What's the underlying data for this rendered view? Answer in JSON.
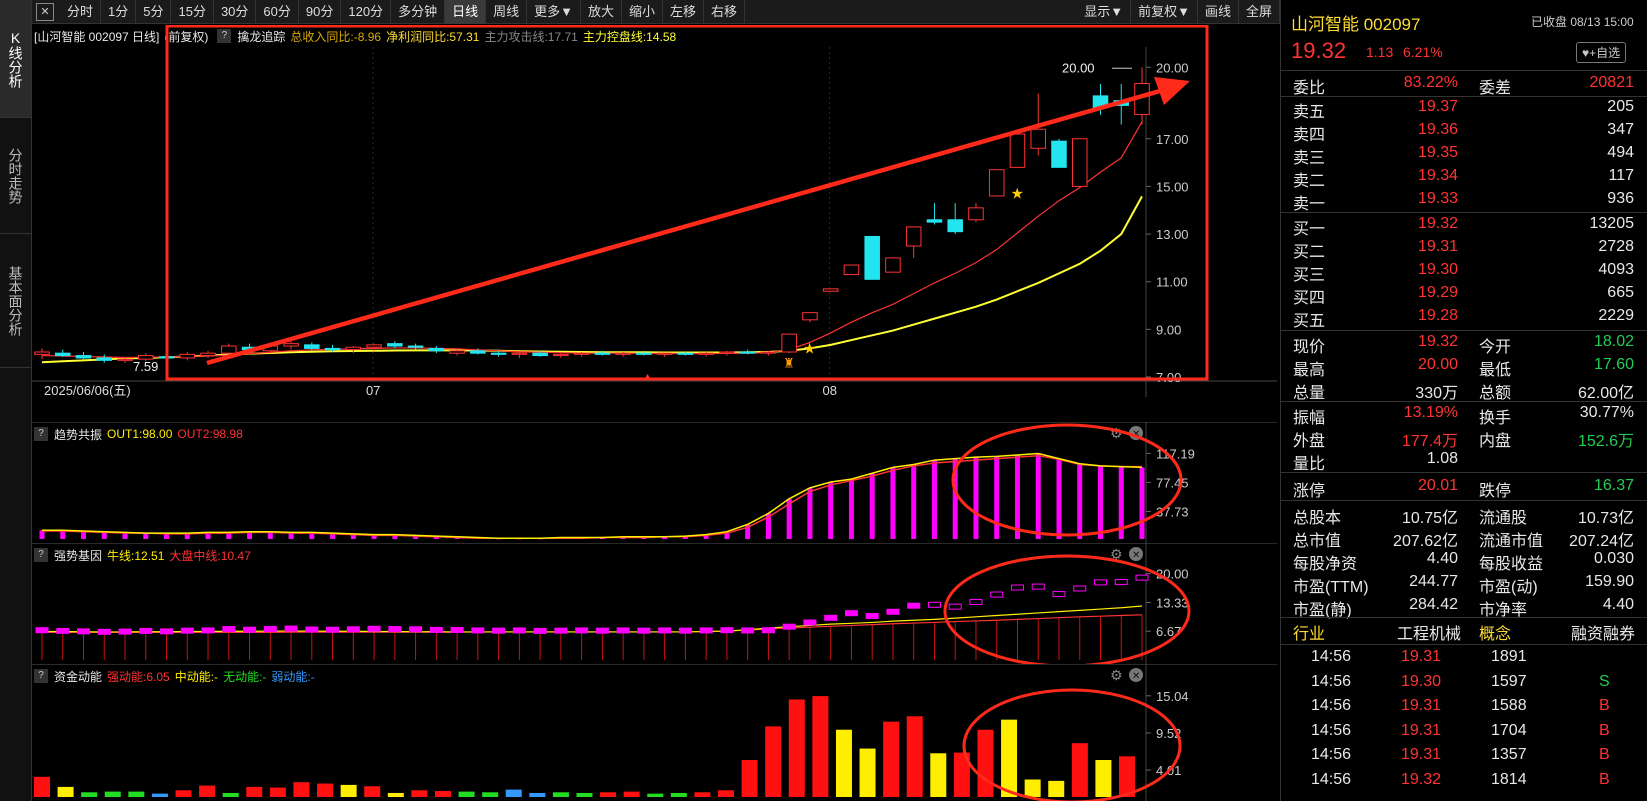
{
  "toolbar": {
    "square_label": "✕",
    "buttons": [
      "分时",
      "1分",
      "5分",
      "15分",
      "30分",
      "60分",
      "90分",
      "120分",
      "多分钟",
      "日线",
      "周线",
      "更多▼",
      "放大",
      "缩小",
      "左移",
      "右移"
    ],
    "right_buttons": [
      "显示▼",
      "前复权▼",
      "画线",
      "全屏"
    ],
    "active": "日线"
  },
  "left_tabs": [
    "K线分析",
    "分时走势",
    "基本面分析"
  ],
  "main_chart": {
    "title": "[山河智能 002097 日线]",
    "adjust": "(前复权)",
    "indicator": "擒龙追踪",
    "f1": "总收入同比:-8.96",
    "f2": "净利润同比:57.31",
    "f3": "主力攻击线:17.71",
    "f4": "主力控盘线:14.58",
    "y_ticks": [
      "20.00",
      "17.00",
      "15.00",
      "13.00",
      "11.00",
      "9.00",
      "7.00"
    ],
    "date_label": "2025/06/06(五)",
    "x_ticks": [
      "07",
      "08"
    ],
    "high_label": "20.00",
    "low_label": "7.59"
  },
  "panel2": {
    "name": "趋势共振",
    "out1": "OUT1:98.00",
    "out2": "OUT2:98.98",
    "y_ticks": [
      "117.19",
      "77.45",
      "37.73"
    ]
  },
  "panel3": {
    "name": "强势基因",
    "bull": "牛线:12.51",
    "market": "大盘中线:10.47",
    "y_ticks": [
      "20.00",
      "13.33",
      "6.67"
    ]
  },
  "panel4": {
    "name": "资金动能",
    "strong": "强动能:6.05",
    "mid": "中动能:-",
    "none": "无动能:-",
    "weak": "弱动能:-",
    "y_ticks": [
      "15.04",
      "9.52",
      "4.01"
    ]
  },
  "chart_data": {
    "type": "candlestick",
    "title": "[山河智能 002097 日线]",
    "ylim": [
      7.0,
      20.6
    ],
    "candles": [
      {
        "o": 7.95,
        "h": 8.2,
        "l": 7.75,
        "c": 8.05
      },
      {
        "o": 8.0,
        "h": 8.15,
        "l": 7.85,
        "c": 7.9
      },
      {
        "o": 7.9,
        "h": 8.05,
        "l": 7.7,
        "c": 7.8
      },
      {
        "o": 7.8,
        "h": 7.95,
        "l": 7.6,
        "c": 7.7
      },
      {
        "o": 7.7,
        "h": 7.85,
        "l": 7.59,
        "c": 7.75
      },
      {
        "o": 7.75,
        "h": 8.0,
        "l": 7.65,
        "c": 7.9
      },
      {
        "o": 7.85,
        "h": 8.0,
        "l": 7.7,
        "c": 7.8
      },
      {
        "o": 7.8,
        "h": 8.05,
        "l": 7.7,
        "c": 7.95
      },
      {
        "o": 7.9,
        "h": 8.1,
        "l": 7.8,
        "c": 8.0
      },
      {
        "o": 8.0,
        "h": 8.4,
        "l": 7.9,
        "c": 8.3
      },
      {
        "o": 8.25,
        "h": 8.4,
        "l": 8.05,
        "c": 8.15
      },
      {
        "o": 8.1,
        "h": 8.35,
        "l": 8.0,
        "c": 8.3
      },
      {
        "o": 8.3,
        "h": 8.5,
        "l": 8.15,
        "c": 8.4
      },
      {
        "o": 8.35,
        "h": 8.45,
        "l": 8.1,
        "c": 8.2
      },
      {
        "o": 8.2,
        "h": 8.35,
        "l": 8.05,
        "c": 8.15
      },
      {
        "o": 8.15,
        "h": 8.3,
        "l": 8.0,
        "c": 8.25
      },
      {
        "o": 8.25,
        "h": 8.4,
        "l": 8.1,
        "c": 8.35
      },
      {
        "o": 8.4,
        "h": 8.5,
        "l": 8.2,
        "c": 8.3
      },
      {
        "o": 8.3,
        "h": 8.4,
        "l": 8.15,
        "c": 8.25
      },
      {
        "o": 8.2,
        "h": 8.3,
        "l": 8.0,
        "c": 8.1
      },
      {
        "o": 8.0,
        "h": 8.15,
        "l": 7.9,
        "c": 8.1
      },
      {
        "o": 8.1,
        "h": 8.2,
        "l": 7.95,
        "c": 8.0
      },
      {
        "o": 8.0,
        "h": 8.1,
        "l": 7.85,
        "c": 7.95
      },
      {
        "o": 7.95,
        "h": 8.05,
        "l": 7.8,
        "c": 8.0
      },
      {
        "o": 8.0,
        "h": 8.1,
        "l": 7.85,
        "c": 7.9
      },
      {
        "o": 7.9,
        "h": 8.0,
        "l": 7.8,
        "c": 7.95
      },
      {
        "o": 7.95,
        "h": 8.05,
        "l": 7.85,
        "c": 8.0
      },
      {
        "o": 8.0,
        "h": 8.1,
        "l": 7.9,
        "c": 7.95
      },
      {
        "o": 7.95,
        "h": 8.05,
        "l": 7.85,
        "c": 8.0
      },
      {
        "o": 8.0,
        "h": 8.1,
        "l": 7.9,
        "c": 7.95
      },
      {
        "o": 7.95,
        "h": 8.0,
        "l": 7.85,
        "c": 8.0
      },
      {
        "o": 8.0,
        "h": 8.05,
        "l": 7.9,
        "c": 7.95
      },
      {
        "o": 7.95,
        "h": 8.05,
        "l": 7.85,
        "c": 8.0
      },
      {
        "o": 8.0,
        "h": 8.1,
        "l": 7.9,
        "c": 8.05
      },
      {
        "o": 8.05,
        "h": 8.15,
        "l": 7.95,
        "c": 8.0
      },
      {
        "o": 8.0,
        "h": 8.1,
        "l": 7.9,
        "c": 8.05
      },
      {
        "o": 8.05,
        "h": 8.8,
        "l": 8.0,
        "c": 8.8
      },
      {
        "o": 9.4,
        "h": 9.7,
        "l": 9.3,
        "c": 9.7
      },
      {
        "o": 10.6,
        "h": 10.7,
        "l": 10.6,
        "c": 10.7
      },
      {
        "o": 11.3,
        "h": 11.7,
        "l": 11.3,
        "c": 11.7
      },
      {
        "o": 12.9,
        "h": 12.9,
        "l": 11.1,
        "c": 11.1
      },
      {
        "o": 11.4,
        "h": 12.0,
        "l": 11.4,
        "c": 12.0
      },
      {
        "o": 12.5,
        "h": 13.3,
        "l": 12.0,
        "c": 13.3
      },
      {
        "o": 13.6,
        "h": 14.3,
        "l": 13.4,
        "c": 13.5
      },
      {
        "o": 13.6,
        "h": 14.3,
        "l": 13.0,
        "c": 13.1
      },
      {
        "o": 13.6,
        "h": 14.3,
        "l": 13.5,
        "c": 14.1
      },
      {
        "o": 14.6,
        "h": 15.7,
        "l": 14.6,
        "c": 15.7
      },
      {
        "o": 15.8,
        "h": 17.2,
        "l": 15.8,
        "c": 17.2
      },
      {
        "o": 16.6,
        "h": 18.9,
        "l": 16.3,
        "c": 17.4
      },
      {
        "o": 16.9,
        "h": 17.0,
        "l": 15.8,
        "c": 15.8
      },
      {
        "o": 15.0,
        "h": 17.0,
        "l": 14.95,
        "c": 17.0
      },
      {
        "o": 18.8,
        "h": 19.3,
        "l": 18.0,
        "c": 18.3
      },
      {
        "o": 18.6,
        "h": 19.3,
        "l": 17.6,
        "c": 18.4
      },
      {
        "o": 18.02,
        "h": 20.0,
        "l": 17.6,
        "c": 19.32
      }
    ],
    "ma_fast": [
      7.9,
      7.88,
      7.86,
      7.84,
      7.82,
      7.83,
      7.84,
      7.86,
      7.88,
      7.92,
      7.98,
      8.04,
      8.1,
      8.14,
      8.16,
      8.18,
      8.2,
      8.22,
      8.22,
      8.2,
      8.18,
      8.14,
      8.1,
      8.06,
      8.04,
      8.02,
      8.0,
      8.0,
      8.0,
      7.99,
      7.99,
      7.98,
      7.98,
      7.99,
      8.0,
      8.02,
      8.15,
      8.45,
      8.85,
      9.3,
      9.7,
      10.05,
      10.5,
      10.95,
      11.35,
      11.8,
      12.35,
      13.05,
      13.75,
      14.4,
      14.95,
      15.6,
      16.2,
      17.71
    ],
    "ma_slow": [
      7.62,
      7.66,
      7.7,
      7.74,
      7.78,
      7.8,
      7.83,
      7.86,
      7.9,
      7.94,
      7.98,
      8.01,
      8.04,
      8.06,
      8.08,
      8.09,
      8.1,
      8.11,
      8.12,
      8.12,
      8.12,
      8.11,
      8.1,
      8.08,
      8.07,
      8.06,
      8.05,
      8.04,
      8.04,
      8.04,
      8.03,
      8.03,
      8.03,
      8.03,
      8.04,
      8.05,
      8.1,
      8.2,
      8.35,
      8.55,
      8.75,
      8.95,
      9.2,
      9.45,
      9.7,
      9.95,
      10.25,
      10.6,
      10.95,
      11.35,
      11.75,
      12.3,
      13.0,
      14.58
    ],
    "trend_out1": [
      12,
      12,
      11,
      10,
      9,
      8,
      8,
      8,
      9,
      9,
      10,
      10,
      9,
      9,
      8,
      7,
      6,
      6,
      5,
      4,
      3,
      2,
      1,
      1,
      1,
      2,
      2,
      2,
      3,
      3,
      3,
      4,
      6,
      10,
      20,
      35,
      55,
      70,
      78,
      82,
      90,
      98,
      102,
      108,
      110,
      112,
      113,
      115,
      117,
      110,
      103,
      100,
      99,
      98
    ],
    "trend_out2": [
      11,
      11,
      10,
      9,
      8,
      8,
      7,
      7,
      8,
      8,
      9,
      9,
      8,
      8,
      7,
      6,
      5,
      5,
      4,
      3,
      2,
      1,
      1,
      1,
      1,
      1,
      1,
      2,
      2,
      2,
      3,
      3,
      5,
      8,
      16,
      30,
      48,
      65,
      74,
      80,
      86,
      94,
      100,
      104,
      106,
      108,
      110,
      112,
      114,
      109,
      102,
      100,
      99,
      98.98
    ],
    "gene_bull": [
      6.6,
      6.6,
      6.55,
      6.5,
      6.5,
      6.55,
      6.55,
      6.6,
      6.6,
      6.65,
      6.65,
      6.7,
      6.7,
      6.7,
      6.65,
      6.65,
      6.6,
      6.6,
      6.55,
      6.55,
      6.5,
      6.5,
      6.5,
      6.5,
      6.5,
      6.5,
      6.5,
      6.5,
      6.5,
      6.5,
      6.5,
      6.5,
      6.6,
      6.7,
      7.0,
      7.4,
      7.7,
      8.0,
      8.3,
      8.5,
      8.7,
      9.0,
      9.2,
      9.4,
      9.7,
      10.0,
      10.3,
      10.6,
      10.9,
      11.2,
      11.5,
      11.8,
      12.1,
      12.51
    ],
    "gene_market": [
      6.4,
      6.4,
      6.4,
      6.4,
      6.4,
      6.4,
      6.4,
      6.4,
      6.4,
      6.4,
      6.4,
      6.4,
      6.45,
      6.45,
      6.45,
      6.45,
      6.45,
      6.45,
      6.45,
      6.45,
      6.45,
      6.5,
      6.5,
      6.5,
      6.5,
      6.5,
      6.5,
      6.5,
      6.5,
      6.5,
      6.5,
      6.5,
      6.6,
      6.7,
      6.9,
      7.2,
      7.4,
      7.6,
      7.8,
      8.0,
      8.2,
      8.4,
      8.55,
      8.7,
      8.9,
      9.05,
      9.2,
      9.4,
      9.6,
      9.8,
      10.0,
      10.15,
      10.3,
      10.47
    ],
    "energy": [
      {
        "v": 3.0,
        "c": "#ff1111"
      },
      {
        "v": 1.5,
        "c": "#ffee00"
      },
      {
        "v": 0.7,
        "c": "#22dd22"
      },
      {
        "v": 0.8,
        "c": "#22dd22"
      },
      {
        "v": 0.8,
        "c": "#22dd22"
      },
      {
        "v": 0.5,
        "c": "#3399ff"
      },
      {
        "v": 1.0,
        "c": "#ff1111"
      },
      {
        "v": 1.7,
        "c": "#ff1111"
      },
      {
        "v": 0.6,
        "c": "#22dd22"
      },
      {
        "v": 1.5,
        "c": "#ff1111"
      },
      {
        "v": 1.4,
        "c": "#ff1111"
      },
      {
        "v": 2.2,
        "c": "#ff1111"
      },
      {
        "v": 2.0,
        "c": "#ff1111"
      },
      {
        "v": 1.8,
        "c": "#ffee00"
      },
      {
        "v": 1.6,
        "c": "#ff1111"
      },
      {
        "v": 0.6,
        "c": "#ffee00"
      },
      {
        "v": 1.0,
        "c": "#ff1111"
      },
      {
        "v": 0.9,
        "c": "#ff1111"
      },
      {
        "v": 0.8,
        "c": "#22dd22"
      },
      {
        "v": 0.7,
        "c": "#22dd22"
      },
      {
        "v": 1.1,
        "c": "#3399ff"
      },
      {
        "v": 0.6,
        "c": "#3399ff"
      },
      {
        "v": 0.7,
        "c": "#22dd22"
      },
      {
        "v": 0.6,
        "c": "#22dd22"
      },
      {
        "v": 0.7,
        "c": "#ff1111"
      },
      {
        "v": 0.8,
        "c": "#ff1111"
      },
      {
        "v": 0.5,
        "c": "#22dd22"
      },
      {
        "v": 0.6,
        "c": "#22dd22"
      },
      {
        "v": 0.7,
        "c": "#ff1111"
      },
      {
        "v": 1.0,
        "c": "#ff1111"
      },
      {
        "v": 5.5,
        "c": "#ff1111"
      },
      {
        "v": 10.5,
        "c": "#ff1111"
      },
      {
        "v": 14.5,
        "c": "#ff1111"
      },
      {
        "v": 15.0,
        "c": "#ff1111"
      },
      {
        "v": 10.0,
        "c": "#ffee00"
      },
      {
        "v": 7.2,
        "c": "#ffee00"
      },
      {
        "v": 11.2,
        "c": "#ff1111"
      },
      {
        "v": 12.0,
        "c": "#ff1111"
      },
      {
        "v": 6.5,
        "c": "#ffee00"
      },
      {
        "v": 6.6,
        "c": "#ff1111"
      },
      {
        "v": 10.0,
        "c": "#ff1111"
      },
      {
        "v": 11.5,
        "c": "#ffee00"
      },
      {
        "v": 2.6,
        "c": "#ffee00"
      },
      {
        "v": 2.4,
        "c": "#ffee00"
      },
      {
        "v": 8.0,
        "c": "#ff1111"
      },
      {
        "v": 5.5,
        "c": "#ffee00"
      },
      {
        "v": 6.05,
        "c": "#ff1111"
      }
    ],
    "energy_ylim": [
      0,
      16.5
    ],
    "trend_ylim": [
      0,
      130
    ],
    "gene_ylim": [
      0,
      22
    ]
  },
  "side": {
    "name": "山河智能 002097",
    "status": "已收盘 08/13 15:00",
    "price": "19.32",
    "change": "1.13",
    "pct": "6.21%",
    "fav": "♥+自选",
    "weibi_label": "委比",
    "weibi": "83.22%",
    "weicha_label": "委差",
    "weicha": "20821",
    "asks": [
      {
        "label": "卖五",
        "price": "19.37",
        "vol": "205"
      },
      {
        "label": "卖四",
        "price": "19.36",
        "vol": "347"
      },
      {
        "label": "卖三",
        "price": "19.35",
        "vol": "494"
      },
      {
        "label": "卖二",
        "price": "19.34",
        "vol": "117"
      },
      {
        "label": "卖一",
        "price": "19.33",
        "vol": "936"
      }
    ],
    "bids": [
      {
        "label": "买一",
        "price": "19.32",
        "vol": "13205"
      },
      {
        "label": "买二",
        "price": "19.31",
        "vol": "2728"
      },
      {
        "label": "买三",
        "price": "19.30",
        "vol": "4093"
      },
      {
        "label": "买四",
        "price": "19.29",
        "vol": "665"
      },
      {
        "label": "买五",
        "price": "19.28",
        "vol": "2229"
      }
    ],
    "stats1": [
      {
        "l1": "现价",
        "v1": "19.32",
        "c1": "red",
        "l2": "今开",
        "v2": "18.02",
        "c2": "green"
      },
      {
        "l1": "最高",
        "v1": "20.00",
        "c1": "red",
        "l2": "最低",
        "v2": "17.60",
        "c2": "green"
      },
      {
        "l1": "总量",
        "v1": "330万",
        "c1": "white",
        "l2": "总额",
        "v2": "62.00亿",
        "c2": "white"
      }
    ],
    "stats2": [
      {
        "l1": "振幅",
        "v1": "13.19%",
        "c1": "red",
        "l2": "换手",
        "v2": "30.77%",
        "c2": "white"
      },
      {
        "l1": "外盘",
        "v1": "177.4万",
        "c1": "red",
        "l2": "内盘",
        "v2": "152.6万",
        "c2": "green"
      },
      {
        "l1": "量比",
        "v1": "1.08",
        "c1": "white",
        "l2": "",
        "v2": "",
        "c2": "white"
      }
    ],
    "stats3": [
      {
        "l1": "涨停",
        "v1": "20.01",
        "c1": "red",
        "l2": "跌停",
        "v2": "16.37",
        "c2": "green"
      }
    ],
    "stats4": [
      {
        "l1": "总股本",
        "v1": "10.75亿",
        "l2": "流通股",
        "v2": "10.73亿"
      },
      {
        "l1": "总市值",
        "v1": "207.62亿",
        "l2": "流通市值",
        "v2": "207.24亿"
      },
      {
        "l1": "每股净资",
        "v1": "4.40",
        "l2": "每股收益",
        "v2": "0.030"
      },
      {
        "l1": "市盈(TTM)",
        "v1": "244.77",
        "l2": "市盈(动)",
        "v2": "159.90"
      },
      {
        "l1": "市盈(静)",
        "v1": "284.42",
        "l2": "市净率",
        "v2": "4.40"
      }
    ],
    "tags": {
      "industry_label": "行业",
      "industry": "工程机械",
      "concept_label": "概念",
      "margin": "融资融券"
    },
    "ticks": [
      {
        "t": "14:56",
        "p": "19.31",
        "v": "1891",
        "s": ""
      },
      {
        "t": "14:56",
        "p": "19.30",
        "v": "1597",
        "s": "S"
      },
      {
        "t": "14:56",
        "p": "19.31",
        "v": "1588",
        "s": "B"
      },
      {
        "t": "14:56",
        "p": "19.31",
        "v": "1704",
        "s": "B"
      },
      {
        "t": "14:56",
        "p": "19.31",
        "v": "1357",
        "s": "B"
      },
      {
        "t": "14:56",
        "p": "19.32",
        "v": "1814",
        "s": "B"
      }
    ]
  },
  "colors": {
    "up": "#ff3333",
    "down": "#22e5f0",
    "ma_fast": "#ff3333",
    "ma_slow": "#ffff33",
    "annotation": "#ff2a1a",
    "magenta": "#ff00ff",
    "yellow": "#ffee00"
  }
}
